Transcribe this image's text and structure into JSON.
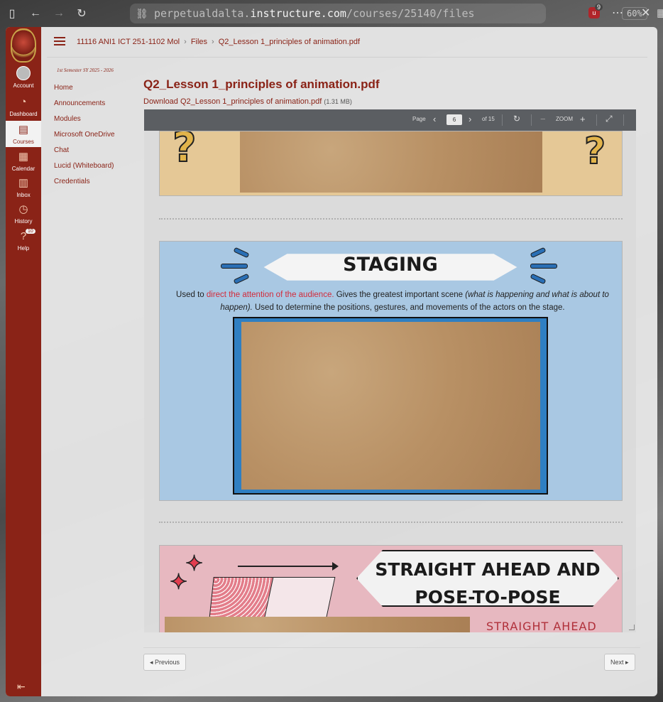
{
  "browser": {
    "url_prefix": "perpetualdalta.",
    "url_domain": "instructure.com",
    "url_path": "/courses/25140/files",
    "zoom": "60%",
    "extension_badge": "9"
  },
  "global_nav": {
    "items": [
      {
        "label": "Account"
      },
      {
        "label": "Dashboard"
      },
      {
        "label": "Courses"
      },
      {
        "label": "Calendar"
      },
      {
        "label": "Inbox"
      },
      {
        "label": "History"
      },
      {
        "label": "Help"
      }
    ],
    "help_badge": "10"
  },
  "breadcrumb": {
    "course": "11116 ANI1 ICT 251-1102 Mol",
    "section": "Files",
    "file": "Q2_Lesson 1_principles of animation.pdf"
  },
  "course_nav": {
    "term": "1st Semester SY 2025 - 2026",
    "items": [
      "Home",
      "Announcements",
      "Modules",
      "Microsoft OneDrive",
      "Chat",
      "Lucid (Whiteboard)",
      "Credentials"
    ]
  },
  "file": {
    "title": "Q2_Lesson 1_principles of animation.pdf",
    "download_label": "Download Q2_Lesson 1_principles of animation.pdf",
    "size": "(1.31 MB)"
  },
  "viewer": {
    "page_label": "Page",
    "current_page": "6",
    "total_label": "of 15",
    "zoom_label": "ZOOM"
  },
  "slides": {
    "staging_title": "STAGING",
    "staging_desc_pre": "Used to ",
    "staging_desc_highlight": "direct the attention of the audience.",
    "staging_desc_mid": " Gives the greatest important scene ",
    "staging_desc_italic": "(what is happening and what is about to happen).",
    "staging_desc_post": " Used to determine the positions, gestures, and movements of the actors on the stage.",
    "s3_title_line1": "STRAIGHT AHEAD AND",
    "s3_title_line2": "POSE-TO-POSE",
    "s3_subtitle": "STRAIGHT AHEAD"
  },
  "pagination": {
    "previous": "◂ Previous",
    "next": "Next ▸"
  }
}
